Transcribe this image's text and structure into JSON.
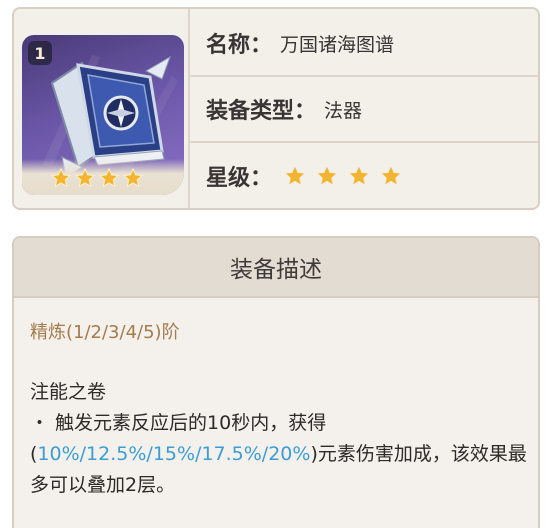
{
  "item": {
    "level": "1",
    "thumbnail_icon": "catalyst-book-icon",
    "rarity_stars": 4
  },
  "info": {
    "name_label": "名称",
    "name_value": "万国诸海图谱",
    "type_label": "装备类型",
    "type_value": "法器",
    "rarity_label": "星级",
    "colon": "："
  },
  "description": {
    "header": "装备描述",
    "refine_line": "精炼(1/2/3/4/5)阶",
    "effect_title": "注能之卷",
    "effect_prefix": "・ 触发元素反应后的10秒内，获得(",
    "effect_values": "10%/12.5%/15%/17.5%/20%",
    "effect_suffix": ")元素伤害加成，该效果最多可以叠加2层。"
  },
  "colors": {
    "star": "#f3b52e",
    "highlight": "#3a9ed4",
    "refine_text": "#a47c4c",
    "card_bg": "#f3efe9",
    "header_bg": "#e3dcd2"
  }
}
